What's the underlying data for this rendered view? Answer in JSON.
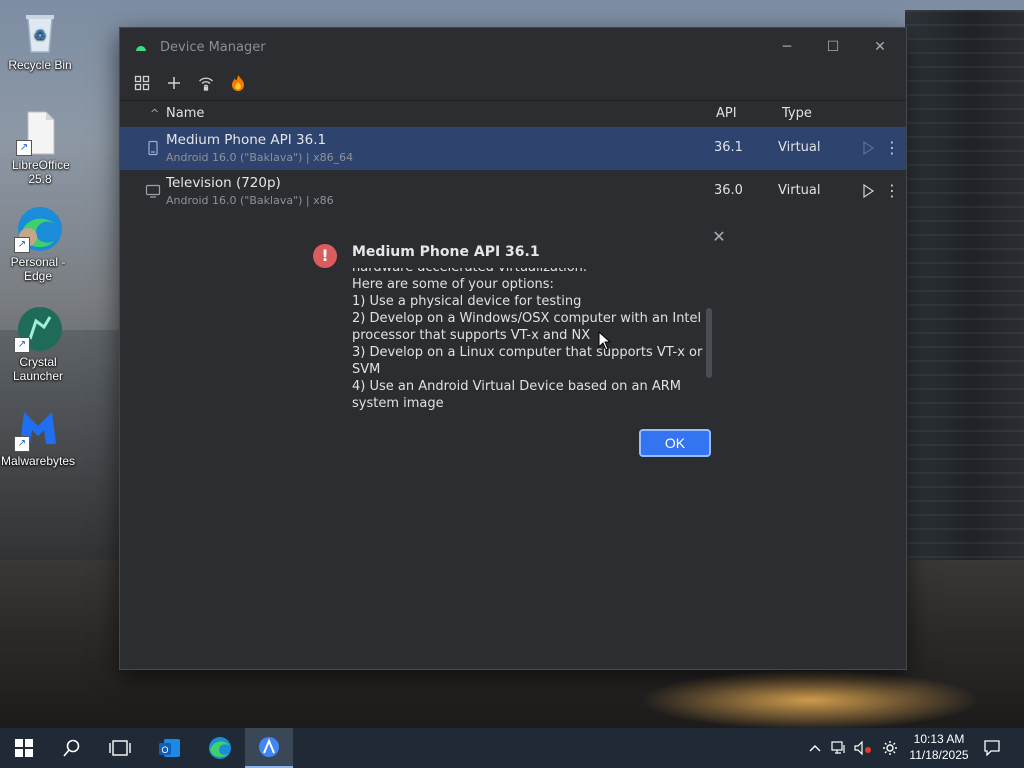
{
  "desktop": {
    "icons": [
      {
        "label": "Recycle Bin"
      },
      {
        "label": "LibreOffice 25.8"
      },
      {
        "label": "Personal - Edge"
      },
      {
        "label": "Crystal Launcher"
      },
      {
        "label": "Malwarebytes"
      }
    ]
  },
  "window": {
    "title": "Device Manager",
    "controls": {
      "minimize": "─",
      "maximize": "☐",
      "close": "✕"
    }
  },
  "toolbar": {
    "icons": [
      "device-group-icon",
      "add-icon",
      "wifi-pairing-icon",
      "firebase-icon"
    ]
  },
  "table": {
    "headers": {
      "name": "Name",
      "api": "API",
      "type": "Type"
    },
    "rows": [
      {
        "name": "Medium Phone API 36.1",
        "sub": "Android 16.0 (\"Baklava\") | x86_64",
        "api": "36.1",
        "type": "Virtual",
        "selected": true
      },
      {
        "name": "Television (720p)",
        "sub": "Android 16.0 (\"Baklava\") | x86",
        "api": "36.0",
        "type": "Virtual",
        "selected": false
      }
    ]
  },
  "dialog": {
    "title": "Medium Phone API 36.1",
    "lines": [
      "hardware accelerated virtualization.",
      "Here are some of your options:",
      "1) Use a physical device for testing",
      "2) Develop on a Windows/OSX computer with an Intel processor that supports VT-x and NX",
      "3) Develop on a Linux computer that supports VT-x or SVM",
      "4) Use an Android Virtual Device based on an ARM system image"
    ],
    "ok_label": "OK"
  },
  "taskbar": {
    "clock_time": "10:13 AM",
    "clock_date": "11/18/2025"
  },
  "colors": {
    "window_bg": "#2b2d30",
    "selected_row": "#2e436e",
    "accent": "#3574f0",
    "error": "#db5c5c"
  }
}
